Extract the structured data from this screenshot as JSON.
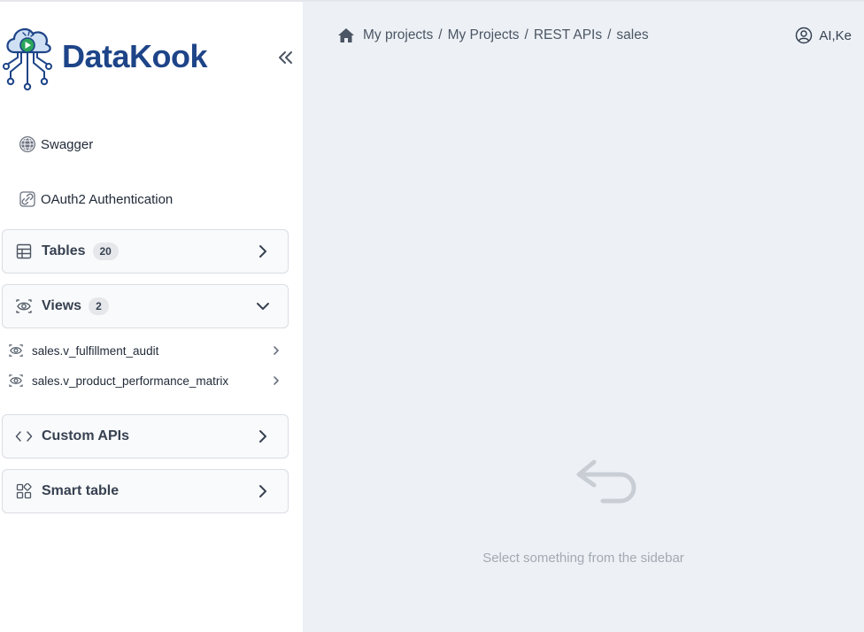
{
  "brand": {
    "name": "DataKook",
    "color": "#1e4488"
  },
  "sidebar": {
    "links": [
      {
        "label": "Swagger",
        "icon": "globe-icon"
      },
      {
        "label": "OAuth2 Authentication",
        "icon": "link-icon"
      }
    ],
    "sections": {
      "tables": {
        "label": "Tables",
        "count": "20",
        "expanded": false,
        "icon": "table-icon"
      },
      "views": {
        "label": "Views",
        "count": "2",
        "expanded": true,
        "icon": "eye-icon",
        "items": [
          {
            "label": "sales.v_fulfillment_audit"
          },
          {
            "label": "sales.v_product_performance_matrix"
          }
        ]
      },
      "custom_apis": {
        "label": "Custom APIs",
        "expanded": false,
        "icon": "code-icon"
      },
      "smart_table": {
        "label": "Smart table",
        "expanded": false,
        "icon": "grid-icon"
      }
    }
  },
  "header": {
    "breadcrumb": [
      "My projects",
      "My Projects",
      "REST APIs",
      "sales"
    ],
    "separator": "/",
    "user": "AI,Ke"
  },
  "main": {
    "empty_state": {
      "text": "Select something from the sidebar",
      "icon": "return-arrow-icon"
    }
  }
}
